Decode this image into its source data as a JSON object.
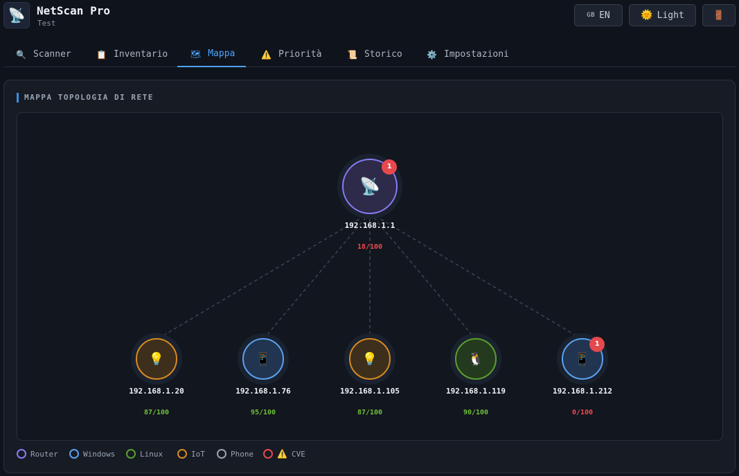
{
  "header": {
    "logo_icon": "📡",
    "title": "NetScan Pro",
    "subtitle": "Test",
    "lang_flag": "GB",
    "lang_label": "EN",
    "theme_icon": "🌞",
    "theme_label": "Light",
    "exit_icon": "🚪"
  },
  "tabs": [
    {
      "icon": "🔍",
      "label": "Scanner"
    },
    {
      "icon": "📋",
      "label": "Inventario"
    },
    {
      "icon": "🗺",
      "label": "Mappa",
      "active": true
    },
    {
      "icon": "⚠️",
      "label": "Priorità"
    },
    {
      "icon": "📜",
      "label": "Storico"
    },
    {
      "icon": "⚙️",
      "label": "Impostazioni"
    }
  ],
  "panel": {
    "title": "MAPPA TOPOLOGIA DI RETE"
  },
  "map": {
    "router": {
      "icon": "📡",
      "ip": "192.168.1.1",
      "score": "18/100",
      "score_status": "bad",
      "cve_badge": "1",
      "type": "router"
    },
    "devices": [
      {
        "icon": "💡",
        "ip": "192.168.1.20",
        "score": "87/100",
        "score_status": "good",
        "type": "iot",
        "cve_badge": ""
      },
      {
        "icon": "📱",
        "ip": "192.168.1.76",
        "score": "95/100",
        "score_status": "good",
        "type": "windows",
        "cve_badge": ""
      },
      {
        "icon": "💡",
        "ip": "192.168.1.105",
        "score": "87/100",
        "score_status": "good",
        "type": "iot",
        "cve_badge": ""
      },
      {
        "icon": "🐧",
        "ip": "192.168.1.119",
        "score": "90/100",
        "score_status": "good",
        "type": "linux",
        "cve_badge": ""
      },
      {
        "icon": "📱",
        "ip": "192.168.1.212",
        "score": "0/100",
        "score_status": "bad",
        "type": "windows",
        "cve_badge": "1"
      }
    ]
  },
  "legend": [
    {
      "label": "Router",
      "color": "#8b7cf6"
    },
    {
      "label": "Windows",
      "color": "#5aa2f0"
    },
    {
      "label": "Linux",
      "color": "#5aa02c"
    },
    {
      "label": "IoT",
      "color": "#d98a1f"
    },
    {
      "label": "Phone",
      "color": "#9aa4b2"
    },
    {
      "label": "CVE",
      "color": "#e5484d",
      "icon": "⚠️"
    }
  ],
  "colors": {
    "router": {
      "stroke": "#8b7cf6",
      "fill": "#2e2a4a"
    },
    "windows": {
      "stroke": "#5aa2f0",
      "fill": "#223550"
    },
    "linux": {
      "stroke": "#5aa02c",
      "fill": "#243a1e"
    },
    "iot": {
      "stroke": "#d98a1f",
      "fill": "#3d2f1c"
    },
    "good": "#6fbf3a",
    "bad": "#f0494f",
    "accent": "#4da3ff"
  }
}
